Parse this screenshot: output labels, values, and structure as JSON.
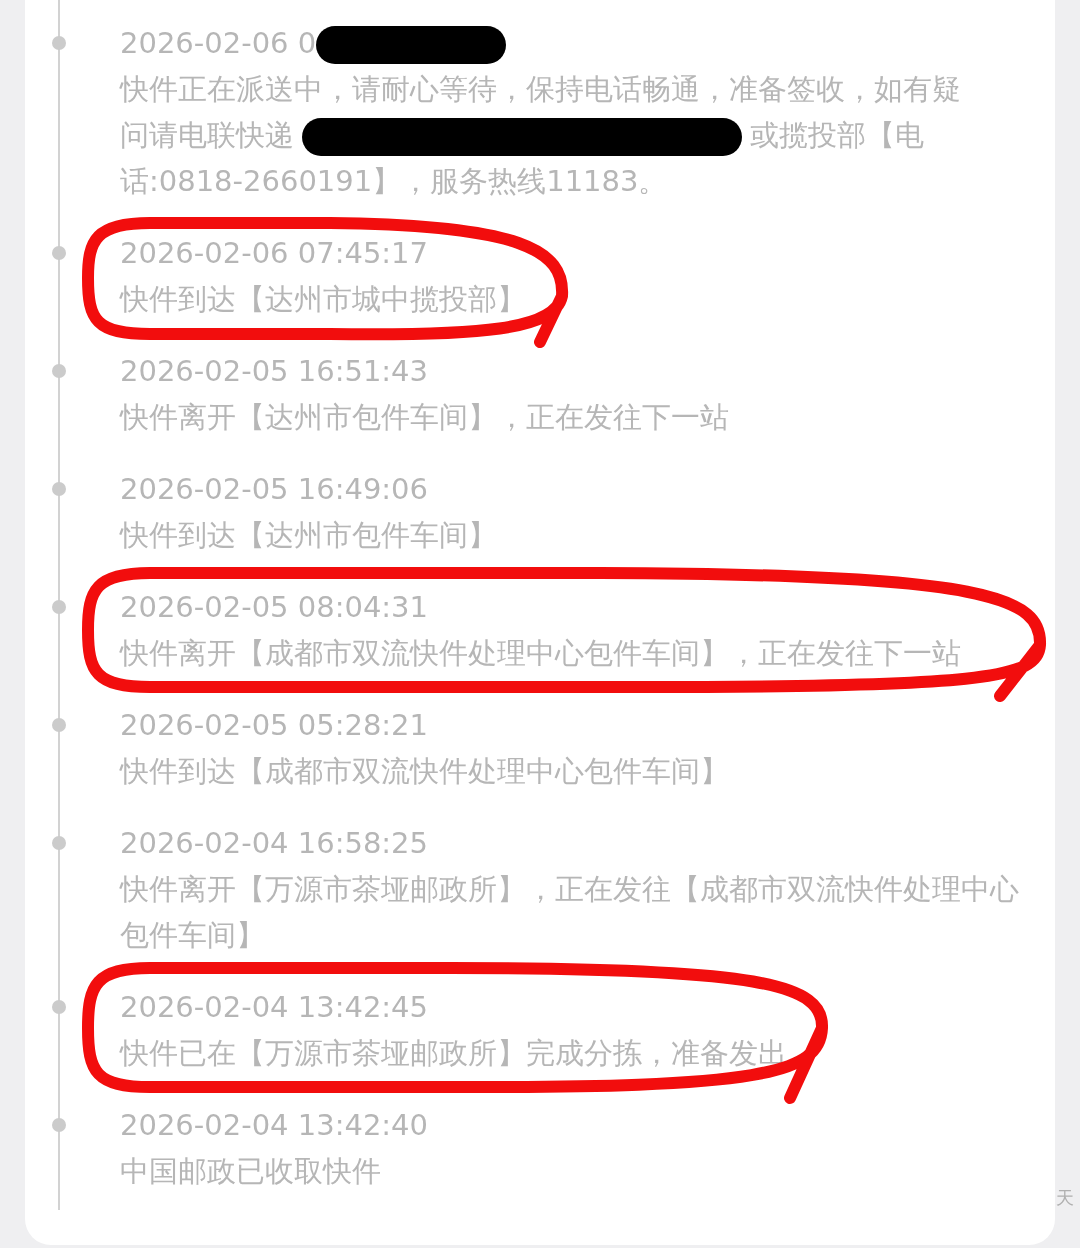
{
  "events": [
    {
      "time": [
        {
          "kind": "text",
          "text": "2026-02-06 0"
        },
        {
          "kind": "redaction"
        }
      ],
      "description": [
        {
          "kind": "text",
          "text": "快件正在派送中，请耐心等待，保持电话畅通，准备签收，如有疑"
        },
        {
          "kind": "text",
          "text": "问请电联快递"
        },
        {
          "kind": "redaction"
        },
        {
          "kind": "text",
          "text": "或揽投部【电"
        },
        {
          "kind": "text",
          "text": "话:0818-2660191】，服务热线11183。"
        }
      ]
    },
    {
      "time": "2026-02-06 07:45:17",
      "description": "快件到达【达州市城中揽投部】"
    },
    {
      "time": "2026-02-05 16:51:43",
      "description": "快件离开【达州市包件车间】，正在发往下一站"
    },
    {
      "time": "2026-02-05 16:49:06",
      "description": "快件到达【达州市包件车间】"
    },
    {
      "time": "2026-02-05 08:04:31",
      "description": "快件离开【成都市双流快件处理中心包件车间】，正在发往下一站"
    },
    {
      "time": "2026-02-05 05:28:21",
      "description": "快件到达【成都市双流快件处理中心包件车间】"
    },
    {
      "time": "2026-02-04 16:58:25",
      "description": "快件离开【万源市茶垭邮政所】，正在发往【成都市双流快件处理中心包件车间】"
    },
    {
      "time": "2026-02-04 13:42:45",
      "description": "快件已在【万源市茶垭邮政所】完成分拣，准备发出"
    },
    {
      "time": "2026-02-04 13:42:40",
      "description": "中国邮政已收取快件"
    }
  ],
  "side_hint": "天"
}
